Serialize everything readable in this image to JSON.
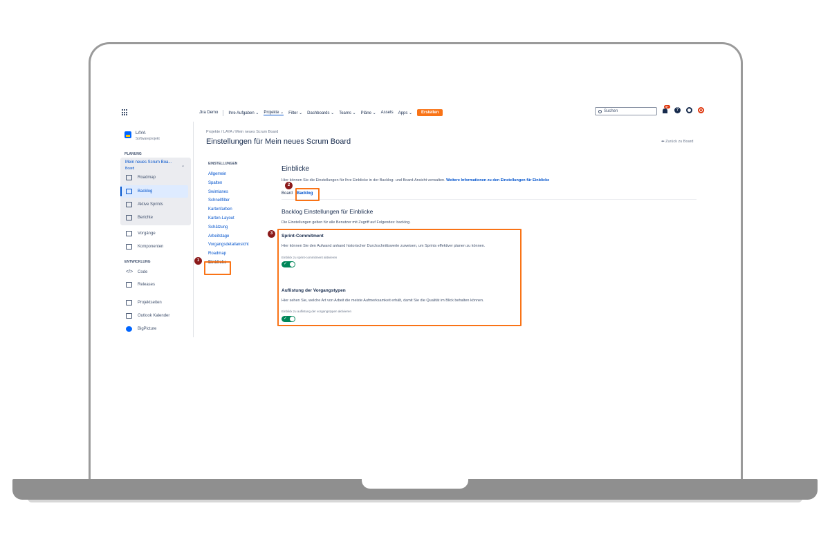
{
  "topnav": {
    "items": [
      "Jira Demo",
      "Ihre Aufgaben ⌄",
      "Projekte ⌄",
      "Filter ⌄",
      "Dashboards ⌄",
      "Teams ⌄",
      "Pläne ⌄",
      "Assets",
      "Apps ⌄"
    ],
    "active_item": "Projekte ⌄",
    "create_label": "Erstellen",
    "search_placeholder": "Suchen",
    "notification_count": "9+",
    "accent_color": "#f97316"
  },
  "sidebar": {
    "project_name": "LAYA",
    "project_type": "Softwareprojekt",
    "planning_label": "PLANUNG",
    "board_name": "Mein neues Scrum Boa...",
    "board_sub": "Board",
    "planning_items": [
      "Roadmap",
      "Backlog",
      "Aktive Sprints",
      "Berichte"
    ],
    "other_items": [
      "Vorgänge",
      "Komponenten"
    ],
    "dev_label": "ENTWICKLUNG",
    "dev_items": [
      "Code",
      "Releases"
    ],
    "bottom_items": [
      "Projektseiten",
      "Outlook Kalender",
      "BigPicture"
    ],
    "active_item": "Backlog"
  },
  "header": {
    "breadcrumb": "Projekte  /  LAYA  /  Mein neues Scrum Board",
    "title": "Einstellungen für Mein neues Scrum Board",
    "back_link": "⬅ Zurück zu Board"
  },
  "settings_nav": {
    "heading": "EINSTELLUNGEN",
    "items": [
      "Allgemein",
      "Spalten",
      "Swimlanes",
      "Schnellfilter",
      "Kartenfarben",
      "Karten-Layout",
      "Schätzung",
      "Arbeitstage",
      "Vorgangsdetailansicht",
      "Roadmap",
      "Einblicke"
    ],
    "active": "Einblicke"
  },
  "content": {
    "title": "Einblicke",
    "desc": "Hier können Sie die Einstellungen für Ihre Einblicke in der Backlog- und Board-Ansicht verwalten.",
    "desc_link": "Weitere Informationen zu den Einstellungen für Einblicke",
    "tabs": [
      "Board",
      "Backlog"
    ],
    "active_tab": "Backlog",
    "subtitle": "Backlog Einstellungen für Einblicke",
    "subdesc": "Die Einstellungen gelten für alle Benutzer mit Zugriff auf Folgendes: backlog.",
    "sections": [
      {
        "title": "Sprint-Commitment",
        "desc": "Hier können Sie den Aufwand anhand historischer Durchschnittswerte zuweisen, um Sprints effektiver planen zu können.",
        "toggle_label": "Einblick zu sprint-commitment aktivieren",
        "enabled": true
      },
      {
        "title": "Auflistung der Vorgangstypen",
        "desc": "Hier sehen Sie, welche Art von Arbeit die meiste Aufmerksamkeit erhält, damit Sie die Qualität im Blick behalten können.",
        "toggle_label": "Einblick zu auflistung der vorgangstypen aktivieren",
        "enabled": true
      }
    ]
  },
  "annotations": {
    "badges": [
      "1",
      "2",
      "3"
    ],
    "highlight_color": "#f97316",
    "badge_color": "#8b1a1a"
  }
}
